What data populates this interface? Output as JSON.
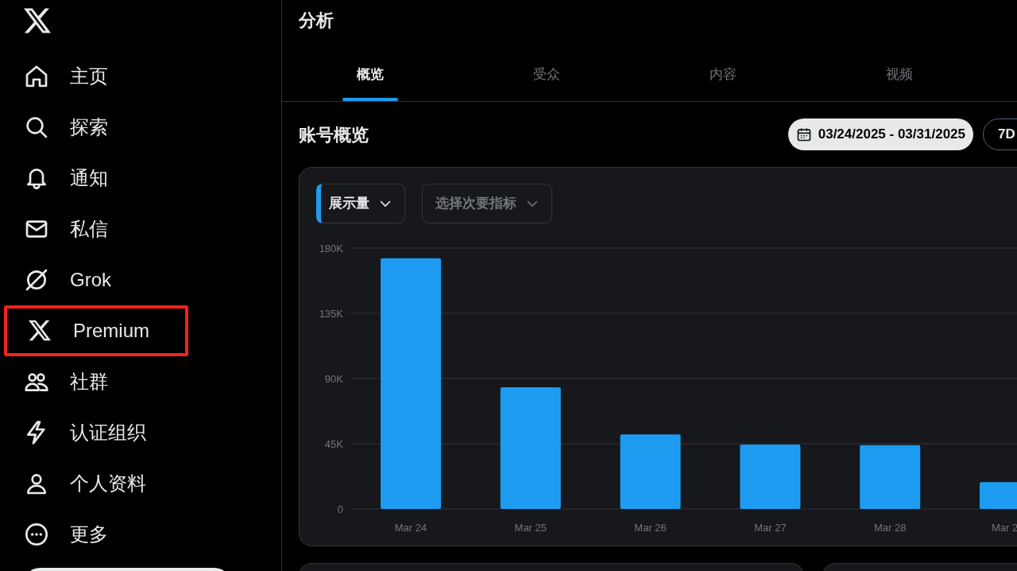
{
  "sidebar": {
    "items": [
      {
        "label": "主页",
        "selected": false,
        "highlighted": false
      },
      {
        "label": "探索",
        "selected": false,
        "highlighted": false
      },
      {
        "label": "通知",
        "selected": false,
        "highlighted": false
      },
      {
        "label": "私信",
        "selected": false,
        "highlighted": false
      },
      {
        "label": "Grok",
        "selected": false,
        "highlighted": false
      },
      {
        "label": "Premium",
        "selected": false,
        "highlighted": true
      },
      {
        "label": "社群",
        "selected": false,
        "highlighted": false
      },
      {
        "label": "认证组织",
        "selected": false,
        "highlighted": false
      },
      {
        "label": "个人资料",
        "selected": false,
        "highlighted": false
      },
      {
        "label": "更多",
        "selected": false,
        "highlighted": false
      }
    ]
  },
  "page_title": "分析",
  "tabs": [
    {
      "label": "概览",
      "selected": true
    },
    {
      "label": "受众",
      "selected": false
    },
    {
      "label": "内容",
      "selected": false
    },
    {
      "label": "视频",
      "selected": false
    }
  ],
  "section_title": "账号概览",
  "date_range": "03/24/2025 - 03/31/2025",
  "range_button": "7D",
  "metric_selectors": [
    {
      "label": "展示量",
      "selected": true
    },
    {
      "label": "选择次要指标",
      "selected": false
    }
  ],
  "chart_data": {
    "type": "bar",
    "categories": [
      "Mar 24",
      "Mar 25",
      "Mar 26",
      "Mar 27",
      "Mar 28",
      "Mar 2"
    ],
    "grid": true,
    "series": [
      {
        "color": "#1d9bf0",
        "values": [
          173000,
          84000,
          51500,
          44500,
          44000,
          18500
        ]
      }
    ],
    "ylim": [
      0,
      180000
    ],
    "yticks": [
      {
        "value": 0,
        "label": "0"
      },
      {
        "value": 45000,
        "label": "45K"
      },
      {
        "value": 90000,
        "label": "90K"
      },
      {
        "value": 135000,
        "label": "135K"
      },
      {
        "value": 180000,
        "label": "180K"
      }
    ]
  }
}
